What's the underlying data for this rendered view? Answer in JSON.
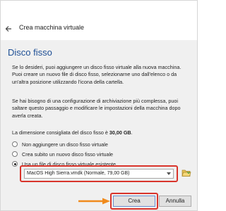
{
  "window": {
    "title": "Crea macchina virtuale"
  },
  "section": {
    "title": "Disco fisso"
  },
  "text": {
    "p1": "Se lo desideri, puoi aggiungere un disco fisso virtuale alla nuova macchina. Puoi creare un nuovo file di disco fisso, selezionarne uno dall'elenco o da un'altra posizione utilizzando l'icona della cartella.",
    "p2": "Se hai bisogno di una configurazione di archiviazione più complessa, puoi saltare questo passaggio e modificare le impostazioni della macchina dopo averla creata.",
    "p3_prefix": "La dimensione consigliata del disco fisso è ",
    "p3_value": "30,00 GB",
    "p3_suffix": "."
  },
  "options": [
    {
      "label": "Non aggiungere un disco fisso virtuale",
      "selected": false
    },
    {
      "label": "Crea subito un nuovo disco fisso virtuale",
      "selected": false
    },
    {
      "label": "Usa un file di disco fisso virtuale esistente",
      "selected": true
    }
  ],
  "disk_select": {
    "value": "MacOS High Sierra.vmdk (Normale, 79,00 GB)"
  },
  "buttons": {
    "create": "Crea",
    "cancel": "Annulla"
  },
  "colors": {
    "title_blue": "#1e4f95",
    "highlight_red": "#d9342b",
    "arrow_orange": "#f08a1c"
  },
  "icons": {
    "back": "back-arrow-icon",
    "folder": "folder-open-icon"
  }
}
